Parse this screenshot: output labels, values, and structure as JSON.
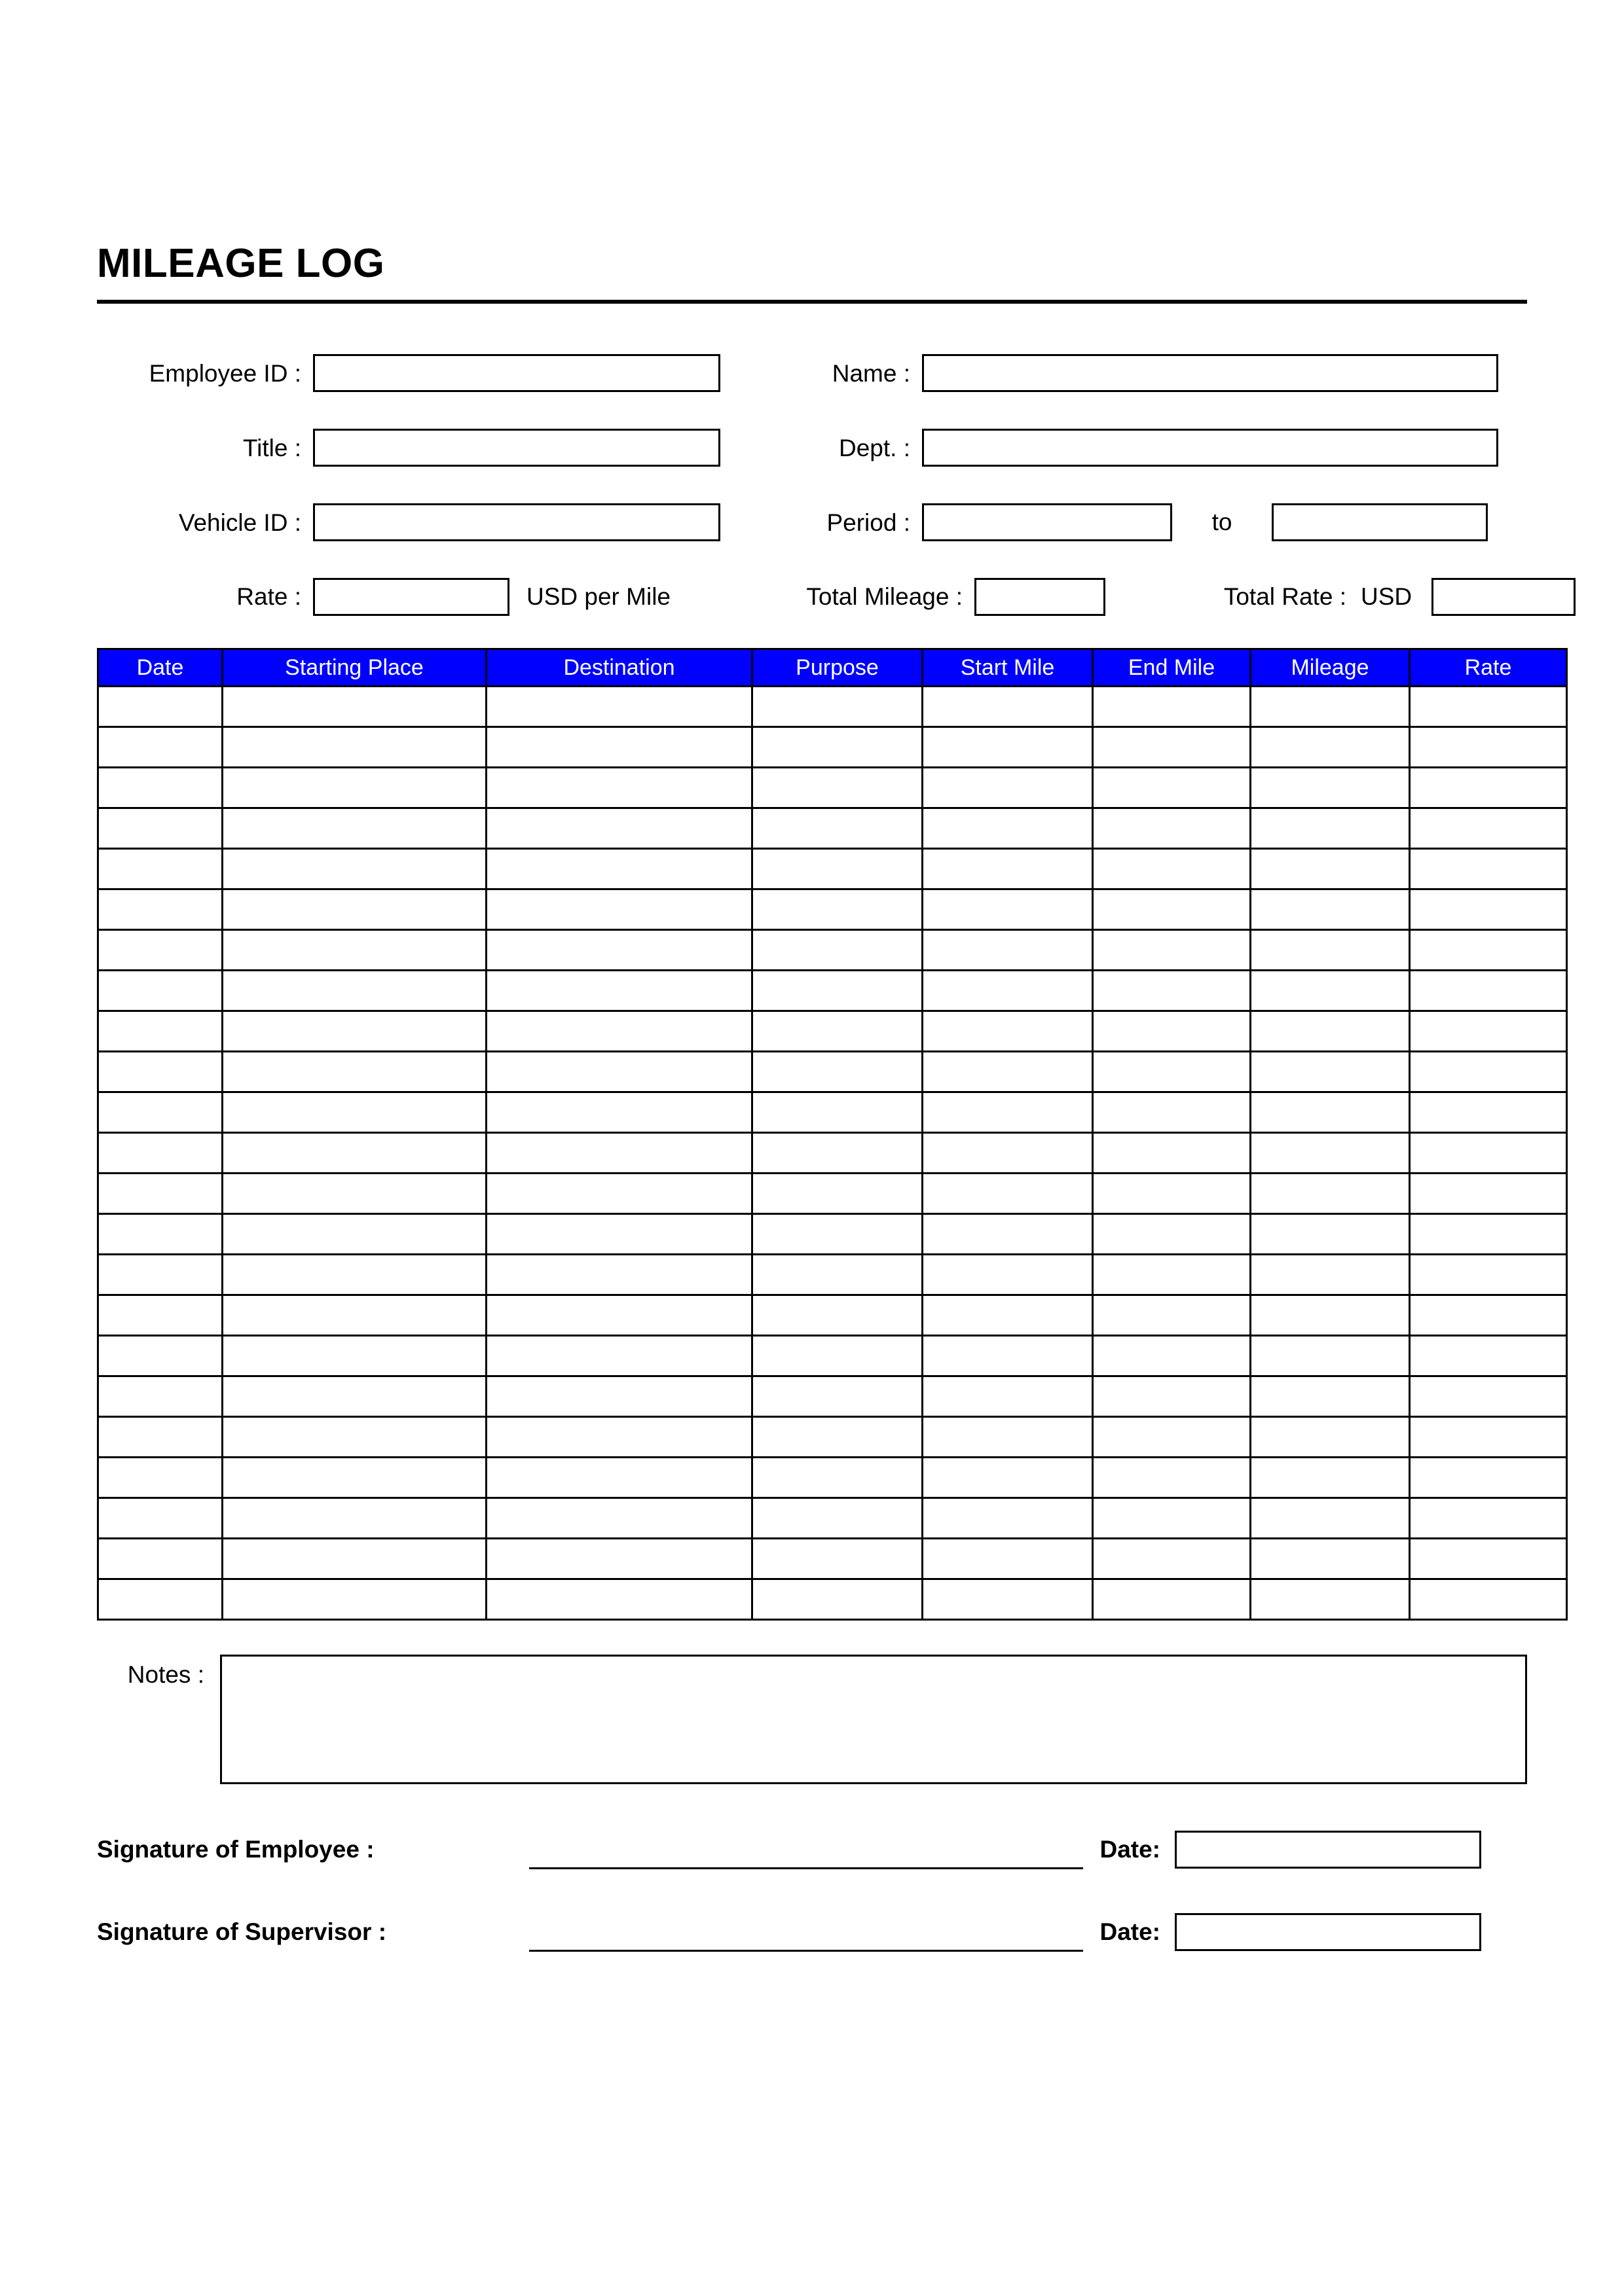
{
  "document": {
    "title": "MILEAGE LOG"
  },
  "meta": {
    "employee_id_label": "Employee ID :",
    "employee_id_value": "",
    "name_label": "Name :",
    "name_value": "",
    "title_label": "Title :",
    "title_value": "",
    "dept_label": "Dept. :",
    "dept_value": "",
    "vehicle_id_label": "Vehicle ID :",
    "vehicle_id_value": "",
    "period_label": "Period :",
    "period_from_value": "",
    "period_to_word": "to",
    "period_to_value": "",
    "rate_label": "Rate :",
    "rate_value": "",
    "rate_unit": "USD per Mile",
    "total_mileage_label": "Total Mileage :",
    "total_mileage_value": "",
    "total_rate_label": "Total Rate :",
    "total_rate_currency": "USD",
    "total_rate_value": ""
  },
  "log_table": {
    "columns": [
      "Date",
      "Starting Place",
      "Destination",
      "Purpose",
      "Start Mile",
      "End Mile",
      "Mileage",
      "Rate"
    ],
    "row_count": 23,
    "rows": [
      [
        "",
        "",
        "",
        "",
        "",
        "",
        "",
        ""
      ],
      [
        "",
        "",
        "",
        "",
        "",
        "",
        "",
        ""
      ],
      [
        "",
        "",
        "",
        "",
        "",
        "",
        "",
        ""
      ],
      [
        "",
        "",
        "",
        "",
        "",
        "",
        "",
        ""
      ],
      [
        "",
        "",
        "",
        "",
        "",
        "",
        "",
        ""
      ],
      [
        "",
        "",
        "",
        "",
        "",
        "",
        "",
        ""
      ],
      [
        "",
        "",
        "",
        "",
        "",
        "",
        "",
        ""
      ],
      [
        "",
        "",
        "",
        "",
        "",
        "",
        "",
        ""
      ],
      [
        "",
        "",
        "",
        "",
        "",
        "",
        "",
        ""
      ],
      [
        "",
        "",
        "",
        "",
        "",
        "",
        "",
        ""
      ],
      [
        "",
        "",
        "",
        "",
        "",
        "",
        "",
        ""
      ],
      [
        "",
        "",
        "",
        "",
        "",
        "",
        "",
        ""
      ],
      [
        "",
        "",
        "",
        "",
        "",
        "",
        "",
        ""
      ],
      [
        "",
        "",
        "",
        "",
        "",
        "",
        "",
        ""
      ],
      [
        "",
        "",
        "",
        "",
        "",
        "",
        "",
        ""
      ],
      [
        "",
        "",
        "",
        "",
        "",
        "",
        "",
        ""
      ],
      [
        "",
        "",
        "",
        "",
        "",
        "",
        "",
        ""
      ],
      [
        "",
        "",
        "",
        "",
        "",
        "",
        "",
        ""
      ],
      [
        "",
        "",
        "",
        "",
        "",
        "",
        "",
        ""
      ],
      [
        "",
        "",
        "",
        "",
        "",
        "",
        "",
        ""
      ],
      [
        "",
        "",
        "",
        "",
        "",
        "",
        "",
        ""
      ],
      [
        "",
        "",
        "",
        "",
        "",
        "",
        "",
        ""
      ],
      [
        "",
        "",
        "",
        "",
        "",
        "",
        "",
        ""
      ]
    ]
  },
  "notes": {
    "label": "Notes :",
    "value": ""
  },
  "signatures": {
    "employee_label": "Signature of Employee :",
    "employee_value": "",
    "employee_date_label": "Date:",
    "employee_date_value": "",
    "supervisor_label": "Signature of Supervisor :",
    "supervisor_value": "",
    "supervisor_date_label": "Date:",
    "supervisor_date_value": ""
  },
  "colors": {
    "header_background": "#0000FF",
    "header_text": "#FFFFFF",
    "border": "#000000",
    "page_background": "#FFFFFF"
  }
}
